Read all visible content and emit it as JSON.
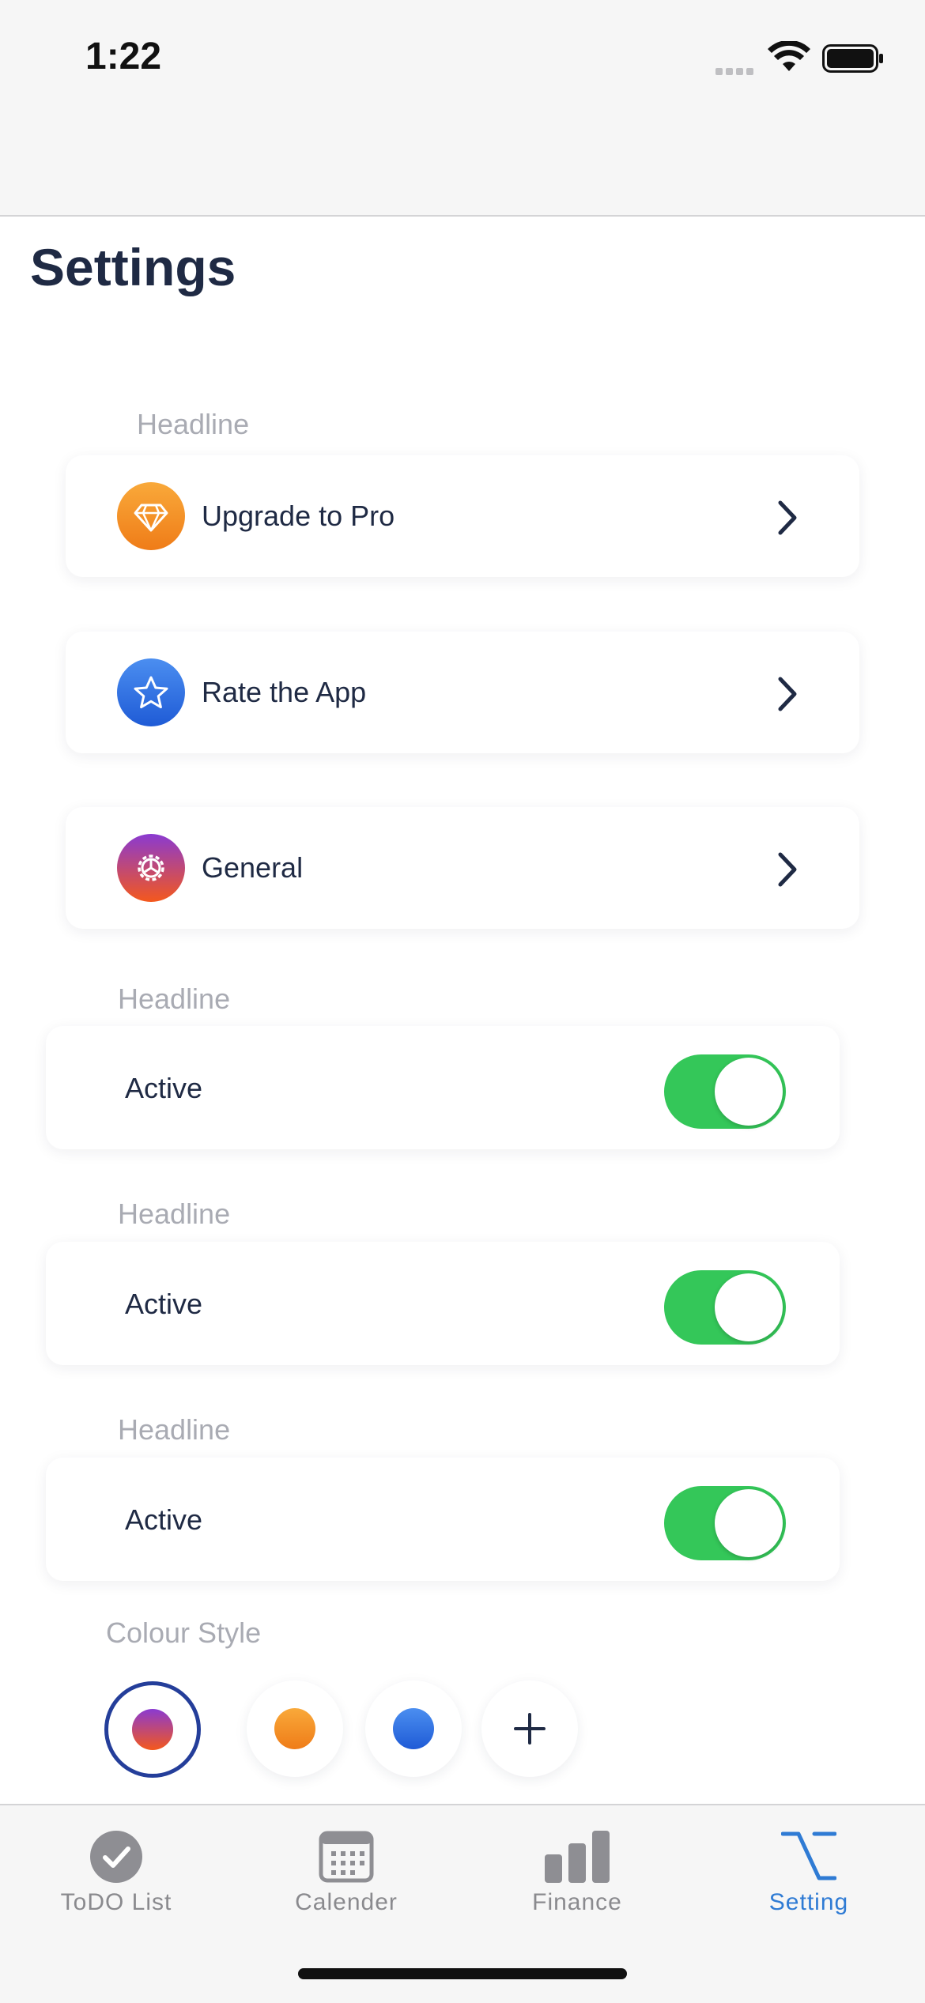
{
  "status_bar": {
    "time": "1:22"
  },
  "page": {
    "title": "Settings"
  },
  "sections": {
    "nav_headline": "Headline",
    "toggle_headlines": [
      "Headline",
      "Headline",
      "Headline"
    ],
    "colour_style": "Colour Style"
  },
  "nav_items": [
    {
      "label": "Upgrade to Pro",
      "icon": "diamond-icon",
      "colors": [
        "#f9a93a",
        "#ef7c18"
      ]
    },
    {
      "label": "Rate the App",
      "icon": "star-icon",
      "colors": [
        "#4b8ef0",
        "#1f5bd6"
      ]
    },
    {
      "label": "General",
      "icon": "gear-icon",
      "colors": [
        "#8a3ad1",
        "#f4581c"
      ]
    }
  ],
  "toggles": [
    {
      "label": "Active",
      "on": true
    },
    {
      "label": "Active",
      "on": true
    },
    {
      "label": "Active",
      "on": true
    }
  ],
  "colour_options": [
    {
      "name": "purple-orange-gradient",
      "selected": true
    },
    {
      "name": "orange"
    },
    {
      "name": "blue"
    },
    {
      "name": "add",
      "icon": "plus-icon"
    }
  ],
  "tabs": [
    {
      "label": "ToDO List",
      "icon": "checkmark-icon"
    },
    {
      "label": "Calender",
      "icon": "calendar-icon"
    },
    {
      "label": "Finance",
      "icon": "bar-chart-icon"
    },
    {
      "label": "Setting",
      "icon": "option-icon",
      "active": true
    }
  ],
  "colors": {
    "accent": "#2f7bd4",
    "switch_on": "#34c759",
    "title": "#1f2a44",
    "muted": "#a9abb3"
  }
}
